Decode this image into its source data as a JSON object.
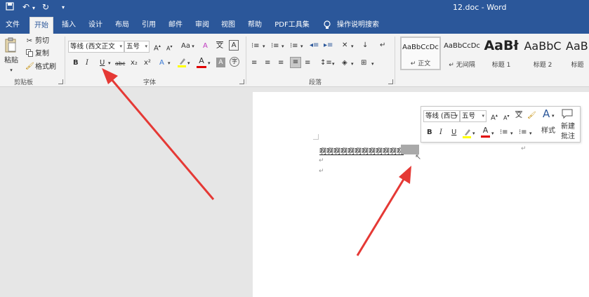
{
  "window": {
    "title": "12.doc  -  Word"
  },
  "tabs": [
    "文件",
    "开始",
    "插入",
    "设计",
    "布局",
    "引用",
    "邮件",
    "审阅",
    "视图",
    "帮助",
    "PDF工具集"
  ],
  "search": {
    "label": "操作说明搜索"
  },
  "clipboard": {
    "paste": "粘贴",
    "cut": "剪切",
    "copy": "复制",
    "format_painter": "格式刷",
    "group": "剪贴板"
  },
  "font": {
    "name": "等线 (西文正文",
    "size": "五号",
    "bold": "B",
    "italic": "I",
    "underline": "U",
    "strike": "abc",
    "sub": "x₂",
    "sup": "x²",
    "grow": "A",
    "shrink": "A",
    "case": "Aa",
    "clear": "A",
    "phonetic": "文",
    "border": "A",
    "font_color": "A",
    "shade": "A",
    "enclose": "字",
    "group": "字体"
  },
  "paragraph": {
    "group": "段落"
  },
  "styles": [
    {
      "sample": "AaBbCcDc",
      "name": "↵ 正文"
    },
    {
      "sample": "AaBbCcDc",
      "name": "↵ 无间隔"
    },
    {
      "sample": "AaBł",
      "name": "标题 1"
    },
    {
      "sample": "AaBbC",
      "name": "标题 2"
    },
    {
      "sample": "AaBl",
      "name": "标题"
    }
  ],
  "document": {
    "text": "啊啊啊啊啊啊啊啊啊啊啊啊",
    "pilcrow": "↵"
  },
  "mini_toolbar": {
    "font": "等线 (西已",
    "size": "五号",
    "styles": "样式",
    "new_comment_1": "新建",
    "new_comment_2": "批注"
  },
  "colors": {
    "accent": "#2b579a",
    "arrow": "#e53935",
    "font_color_bar": "#e00000",
    "highlight_bar": "#ffff00"
  }
}
